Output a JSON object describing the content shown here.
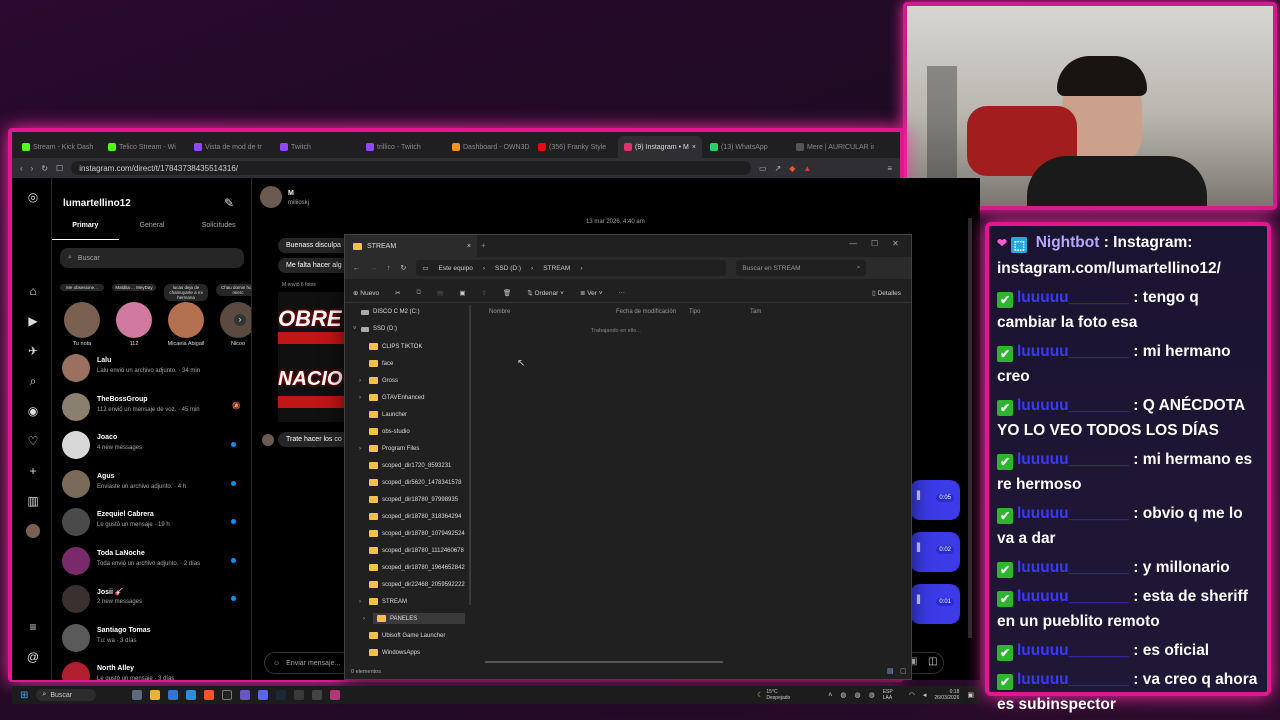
{
  "browser": {
    "tabs": [
      "Stream - Kick Dash",
      "Telico Stream - Wi",
      "Vista de mod de tr",
      "Twitch",
      "trillico - Twitch",
      "Dashboard - OWN3D",
      "(356) Franky Style",
      "(9) Instagram • M",
      "(13) WhatsApp",
      "Mere | AURICULAR in"
    ],
    "active_tab": 7,
    "url": "instagram.com/direct/t/17843738435514316/"
  },
  "instagram": {
    "username": "lumartellino12",
    "tabs": [
      "Primary",
      "General",
      "Solicitudes"
    ],
    "search_placeholder": "Buscar",
    "notes": [
      {
        "caption": "Me obsesione...",
        "name": "Tu nota"
      },
      {
        "caption": "Maldita ... MeyDay",
        "name": "112"
      },
      {
        "caption": "lucas deja de chamuyarte a mi hermana",
        "name": "Micaela Abigail"
      },
      {
        "caption": "Chau domin hola mierc",
        "name": "Nicoo"
      }
    ],
    "conversations": [
      {
        "name": "Lalu",
        "preview": "Lalu envió un archivo adjunto. · 34 min",
        "unread": false
      },
      {
        "name": "TheBossGroup",
        "preview": "112 envió un mensaje de voz. · 45 min",
        "unread": false
      },
      {
        "name": "Joaco",
        "preview": "4 new messages",
        "unread": true
      },
      {
        "name": "Agus",
        "preview": "Enviaste un archivo adjunto. · 4 h",
        "unread": true
      },
      {
        "name": "Ezequiel Cabrera",
        "preview": "Le gustó un mensaje · 19 h",
        "unread": true
      },
      {
        "name": "Toda LaNoche",
        "preview": "Toda envió un archivo adjunto. · 2 días",
        "unread": true
      },
      {
        "name": "Josii 🎸",
        "preview": "2 new messages",
        "unread": true
      },
      {
        "name": "Santiago Tomas",
        "preview": "Tu: wa · 3 días",
        "unread": false
      },
      {
        "name": "North Alley",
        "preview": "Le gustó un mensaje · 3 días",
        "unread": false
      }
    ],
    "chat": {
      "contact": "M",
      "handle": "miliioskj",
      "date": "13 mar 2026, 4:40 am",
      "messages": [
        "Buenass disculpa",
        "Me falta hacer alg",
        "Trate hacer los co"
      ],
      "sent_photos": "M envió 6 fotos",
      "voice_durations": [
        "0:05",
        "0:02",
        "0:01"
      ],
      "input_placeholder": "Enviar mensaje..."
    }
  },
  "explorer": {
    "tab_title": "STREAM",
    "breadcrumb": [
      "Este equipo",
      "SSD (D:)",
      "STREAM"
    ],
    "search_placeholder": "Buscar en STREAM",
    "toolbar": {
      "new": "Nuevo",
      "sort": "Ordenar",
      "view": "Ver",
      "details": "Detalles"
    },
    "columns": [
      "Nombre",
      "Fecha de modificación",
      "Tipo",
      "Tam"
    ],
    "status_msg": "Trabajando en ello...",
    "tree": [
      "DISCO C M2 (C:)",
      "SSD (D:)",
      "CLIPS TIKTOK",
      "face",
      "Gross",
      "GTAVEnhanced",
      "Launcher",
      "obs-studio",
      "Program Files",
      "scoped_dir1720_8593231",
      "scoped_dir5620_1478341578",
      "scoped_dir18780_97998935",
      "scoped_dir18780_318364294",
      "scoped_dir18780_1079492524",
      "scoped_dir18780_1112460678",
      "scoped_dir18780_1964652842",
      "scoped_dir22468_2059592222",
      "STREAM",
      "PANELES",
      "Ubisoft Game Launcher",
      "WindowsApps"
    ],
    "selected_tree": "PANELES",
    "footer": "0 elementos"
  },
  "taskbar": {
    "search": "Buscar",
    "weather_temp": "15°C",
    "weather_text": "Despejado",
    "lang": "ESP LAA",
    "time": "0:18",
    "date": "26/03/2026"
  },
  "chat_overlay": {
    "bot_name": "Nightbot",
    "bot_message": "Instagram: instagram.com/lumartellino12/",
    "messages": [
      {
        "user": "luuuuu_______",
        "text": "tengo q cambiar la foto esa"
      },
      {
        "user": "luuuuu_______",
        "text": "mi hermano creo"
      },
      {
        "user": "luuuuu_______",
        "text": "Q ANÉCDOTA YO LO VEO TODOS LOS DÍAS"
      },
      {
        "user": "luuuuu_______",
        "text": "mi hermano es re hermoso"
      },
      {
        "user": "luuuuu_______",
        "text": "obvio q me lo va a dar"
      },
      {
        "user": "luuuuu_______",
        "text": "y millonario"
      },
      {
        "user": "luuuuu_______",
        "text": "esta de sheriff en un pueblito remoto"
      },
      {
        "user": "luuuuu_______",
        "text": "es oficial"
      },
      {
        "user": "luuuuu_______",
        "text": "va creo q ahora es subinspector"
      }
    ]
  }
}
